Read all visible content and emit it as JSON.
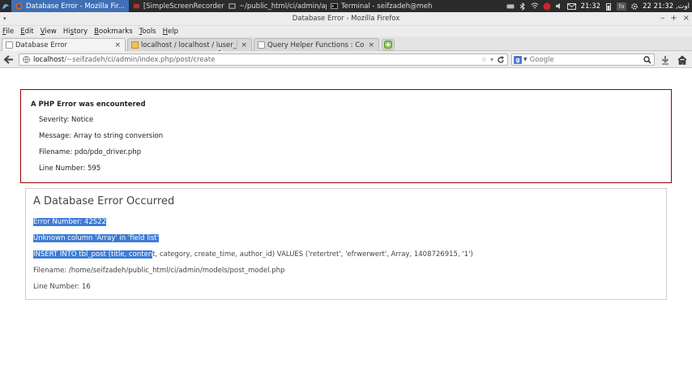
{
  "taskbar": {
    "items": [
      {
        "label": "Database Error - Mozilla Fir...",
        "active": true
      },
      {
        "label": "[SimpleScreenRecorder]",
        "active": false
      },
      {
        "label": "~/public_html/ci/admin/ap...",
        "active": false
      },
      {
        "label": "Terminal - seifzadeh@meh...",
        "active": false
      }
    ],
    "clock": "21:32",
    "date": "22 اوت, 21:32",
    "kb_layout": "fa"
  },
  "window": {
    "title": "Database Error - Mozilla Firefox"
  },
  "menu": {
    "items": [
      {
        "label": "File",
        "mnemonic": "F"
      },
      {
        "label": "Edit",
        "mnemonic": "E"
      },
      {
        "label": "View",
        "mnemonic": "V"
      },
      {
        "label": "History",
        "mnemonic": "s"
      },
      {
        "label": "Bookmarks",
        "mnemonic": "B"
      },
      {
        "label": "Tools",
        "mnemonic": "T"
      },
      {
        "label": "Help",
        "mnemonic": "H"
      }
    ]
  },
  "tabs": [
    {
      "label": "Database Error",
      "selected": true,
      "close": "×"
    },
    {
      "label": "localhost / localhost / luser_blog...",
      "selected": false,
      "close": "×"
    },
    {
      "label": "Query Helper Functions : CodeI...",
      "selected": false,
      "close": "×"
    }
  ],
  "nav": {
    "url_host": "localhost",
    "url_path": "/~seifzadeh/ci/admin/index.php/post/create",
    "search_placeholder": "Google"
  },
  "php_error": {
    "heading": "A PHP Error was encountered",
    "severity": "Severity: Notice",
    "message": "Message: Array to string conversion",
    "filename": "Filename: pdo/pdo_driver.php",
    "line": "Line Number: 595"
  },
  "db_error": {
    "heading": "A Database Error Occurred",
    "error_number": "Error Number: 42S22",
    "unknown_column": "Unknown column 'Array' in 'field list'",
    "query_selected": "INSERT INTO tbl_post (title, conten",
    "query_rest": "t, category, create_time, author_id) VALUES ('retertret', 'efrwerwert', Array, 1408726915, '1')",
    "filename": "Filename: /home/seifzadeh/public_html/ci/admin/models/post_model.php",
    "line": "Line Number: 16"
  },
  "colors": {
    "taskbar_bg": "#2b2b2b",
    "taskbar_active": "#3f6fb5",
    "selection": "#3d7bd6",
    "php_error_border": "#990000"
  }
}
